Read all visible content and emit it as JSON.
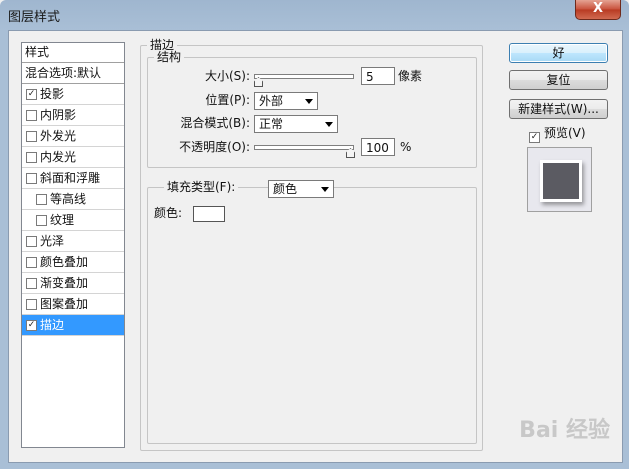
{
  "window": {
    "title": "图层样式",
    "close_label": "X"
  },
  "style_list": {
    "header": "样式",
    "blend_item": "混合选项:默认",
    "items": [
      {
        "label": "投影",
        "checked": true,
        "sub": false,
        "selected": false
      },
      {
        "label": "内阴影",
        "checked": false,
        "sub": false,
        "selected": false
      },
      {
        "label": "外发光",
        "checked": false,
        "sub": false,
        "selected": false
      },
      {
        "label": "内发光",
        "checked": false,
        "sub": false,
        "selected": false
      },
      {
        "label": "斜面和浮雕",
        "checked": false,
        "sub": false,
        "selected": false
      },
      {
        "label": "等高线",
        "checked": false,
        "sub": true,
        "selected": false
      },
      {
        "label": "纹理",
        "checked": false,
        "sub": true,
        "selected": false
      },
      {
        "label": "光泽",
        "checked": false,
        "sub": false,
        "selected": false
      },
      {
        "label": "颜色叠加",
        "checked": false,
        "sub": false,
        "selected": false
      },
      {
        "label": "渐变叠加",
        "checked": false,
        "sub": false,
        "selected": false
      },
      {
        "label": "图案叠加",
        "checked": false,
        "sub": false,
        "selected": false
      },
      {
        "label": "描边",
        "checked": true,
        "sub": false,
        "selected": true
      }
    ]
  },
  "stroke": {
    "title": "描边",
    "structure_title": "结构",
    "size_label": "大小(S):",
    "size_value": "5",
    "size_unit": "像素",
    "position_label": "位置(P):",
    "position_value": "外部",
    "blend_label": "混合模式(B):",
    "blend_value": "正常",
    "opacity_label": "不透明度(O):",
    "opacity_value": "100",
    "opacity_unit": "%",
    "fill_type_label": "填充类型(F):",
    "fill_type_value": "颜色",
    "color_label": "颜色:",
    "color_hex": "#ffffff"
  },
  "buttons": {
    "ok": "好",
    "reset": "复位",
    "new_style": "新建样式(W)...",
    "preview_label": "预览(V)",
    "preview_checked": true
  },
  "watermark": "Bai 经验"
}
